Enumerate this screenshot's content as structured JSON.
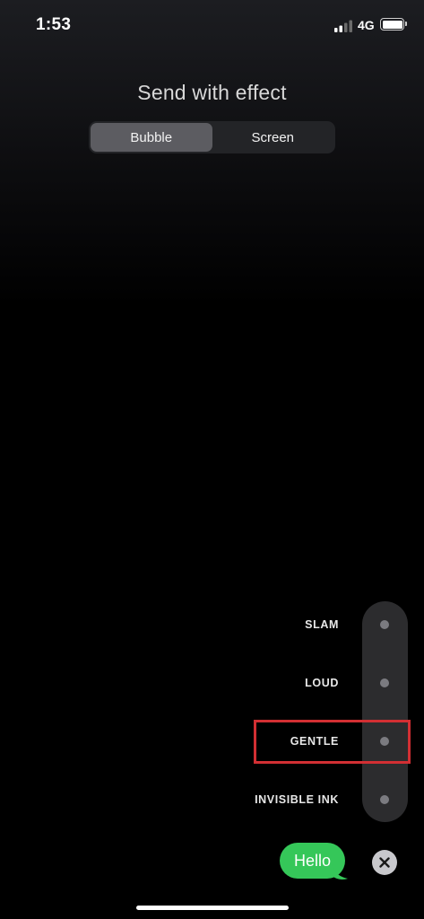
{
  "status_bar": {
    "time": "1:53",
    "network": "4G",
    "signal_icon": "cellular-signal-icon",
    "battery_icon": "battery-icon"
  },
  "title": "Send with effect",
  "tabs": [
    {
      "label": "Bubble",
      "selected": true
    },
    {
      "label": "Screen",
      "selected": false
    }
  ],
  "effects": [
    {
      "label": "SLAM"
    },
    {
      "label": "LOUD"
    },
    {
      "label": "GENTLE",
      "highlighted": true
    },
    {
      "label": "INVISIBLE INK"
    }
  ],
  "message": {
    "text": "Hello",
    "bubble_color": "#35c759"
  },
  "close_icon": "close-icon",
  "colors": {
    "highlight": "#d22f33",
    "segment_active": "#5c5c61",
    "track": "#2c2c2e"
  }
}
